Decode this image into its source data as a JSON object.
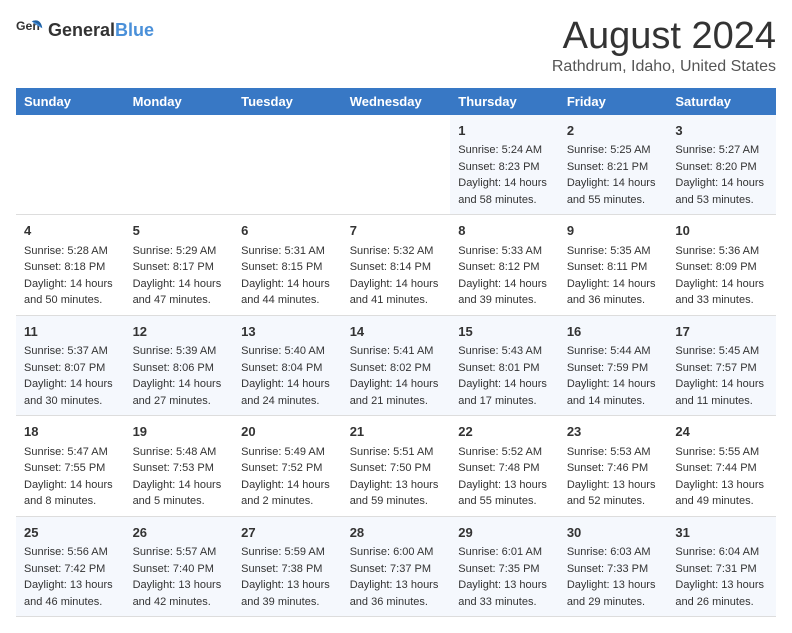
{
  "logo": {
    "general": "General",
    "blue": "Blue"
  },
  "title": "August 2024",
  "subtitle": "Rathdrum, Idaho, United States",
  "days_header": [
    "Sunday",
    "Monday",
    "Tuesday",
    "Wednesday",
    "Thursday",
    "Friday",
    "Saturday"
  ],
  "weeks": [
    [
      {
        "num": "",
        "sunrise": "",
        "sunset": "",
        "daylight": ""
      },
      {
        "num": "",
        "sunrise": "",
        "sunset": "",
        "daylight": ""
      },
      {
        "num": "",
        "sunrise": "",
        "sunset": "",
        "daylight": ""
      },
      {
        "num": "",
        "sunrise": "",
        "sunset": "",
        "daylight": ""
      },
      {
        "num": "1",
        "sunrise": "Sunrise: 5:24 AM",
        "sunset": "Sunset: 8:23 PM",
        "daylight": "Daylight: 14 hours and 58 minutes."
      },
      {
        "num": "2",
        "sunrise": "Sunrise: 5:25 AM",
        "sunset": "Sunset: 8:21 PM",
        "daylight": "Daylight: 14 hours and 55 minutes."
      },
      {
        "num": "3",
        "sunrise": "Sunrise: 5:27 AM",
        "sunset": "Sunset: 8:20 PM",
        "daylight": "Daylight: 14 hours and 53 minutes."
      }
    ],
    [
      {
        "num": "4",
        "sunrise": "Sunrise: 5:28 AM",
        "sunset": "Sunset: 8:18 PM",
        "daylight": "Daylight: 14 hours and 50 minutes."
      },
      {
        "num": "5",
        "sunrise": "Sunrise: 5:29 AM",
        "sunset": "Sunset: 8:17 PM",
        "daylight": "Daylight: 14 hours and 47 minutes."
      },
      {
        "num": "6",
        "sunrise": "Sunrise: 5:31 AM",
        "sunset": "Sunset: 8:15 PM",
        "daylight": "Daylight: 14 hours and 44 minutes."
      },
      {
        "num": "7",
        "sunrise": "Sunrise: 5:32 AM",
        "sunset": "Sunset: 8:14 PM",
        "daylight": "Daylight: 14 hours and 41 minutes."
      },
      {
        "num": "8",
        "sunrise": "Sunrise: 5:33 AM",
        "sunset": "Sunset: 8:12 PM",
        "daylight": "Daylight: 14 hours and 39 minutes."
      },
      {
        "num": "9",
        "sunrise": "Sunrise: 5:35 AM",
        "sunset": "Sunset: 8:11 PM",
        "daylight": "Daylight: 14 hours and 36 minutes."
      },
      {
        "num": "10",
        "sunrise": "Sunrise: 5:36 AM",
        "sunset": "Sunset: 8:09 PM",
        "daylight": "Daylight: 14 hours and 33 minutes."
      }
    ],
    [
      {
        "num": "11",
        "sunrise": "Sunrise: 5:37 AM",
        "sunset": "Sunset: 8:07 PM",
        "daylight": "Daylight: 14 hours and 30 minutes."
      },
      {
        "num": "12",
        "sunrise": "Sunrise: 5:39 AM",
        "sunset": "Sunset: 8:06 PM",
        "daylight": "Daylight: 14 hours and 27 minutes."
      },
      {
        "num": "13",
        "sunrise": "Sunrise: 5:40 AM",
        "sunset": "Sunset: 8:04 PM",
        "daylight": "Daylight: 14 hours and 24 minutes."
      },
      {
        "num": "14",
        "sunrise": "Sunrise: 5:41 AM",
        "sunset": "Sunset: 8:02 PM",
        "daylight": "Daylight: 14 hours and 21 minutes."
      },
      {
        "num": "15",
        "sunrise": "Sunrise: 5:43 AM",
        "sunset": "Sunset: 8:01 PM",
        "daylight": "Daylight: 14 hours and 17 minutes."
      },
      {
        "num": "16",
        "sunrise": "Sunrise: 5:44 AM",
        "sunset": "Sunset: 7:59 PM",
        "daylight": "Daylight: 14 hours and 14 minutes."
      },
      {
        "num": "17",
        "sunrise": "Sunrise: 5:45 AM",
        "sunset": "Sunset: 7:57 PM",
        "daylight": "Daylight: 14 hours and 11 minutes."
      }
    ],
    [
      {
        "num": "18",
        "sunrise": "Sunrise: 5:47 AM",
        "sunset": "Sunset: 7:55 PM",
        "daylight": "Daylight: 14 hours and 8 minutes."
      },
      {
        "num": "19",
        "sunrise": "Sunrise: 5:48 AM",
        "sunset": "Sunset: 7:53 PM",
        "daylight": "Daylight: 14 hours and 5 minutes."
      },
      {
        "num": "20",
        "sunrise": "Sunrise: 5:49 AM",
        "sunset": "Sunset: 7:52 PM",
        "daylight": "Daylight: 14 hours and 2 minutes."
      },
      {
        "num": "21",
        "sunrise": "Sunrise: 5:51 AM",
        "sunset": "Sunset: 7:50 PM",
        "daylight": "Daylight: 13 hours and 59 minutes."
      },
      {
        "num": "22",
        "sunrise": "Sunrise: 5:52 AM",
        "sunset": "Sunset: 7:48 PM",
        "daylight": "Daylight: 13 hours and 55 minutes."
      },
      {
        "num": "23",
        "sunrise": "Sunrise: 5:53 AM",
        "sunset": "Sunset: 7:46 PM",
        "daylight": "Daylight: 13 hours and 52 minutes."
      },
      {
        "num": "24",
        "sunrise": "Sunrise: 5:55 AM",
        "sunset": "Sunset: 7:44 PM",
        "daylight": "Daylight: 13 hours and 49 minutes."
      }
    ],
    [
      {
        "num": "25",
        "sunrise": "Sunrise: 5:56 AM",
        "sunset": "Sunset: 7:42 PM",
        "daylight": "Daylight: 13 hours and 46 minutes."
      },
      {
        "num": "26",
        "sunrise": "Sunrise: 5:57 AM",
        "sunset": "Sunset: 7:40 PM",
        "daylight": "Daylight: 13 hours and 42 minutes."
      },
      {
        "num": "27",
        "sunrise": "Sunrise: 5:59 AM",
        "sunset": "Sunset: 7:38 PM",
        "daylight": "Daylight: 13 hours and 39 minutes."
      },
      {
        "num": "28",
        "sunrise": "Sunrise: 6:00 AM",
        "sunset": "Sunset: 7:37 PM",
        "daylight": "Daylight: 13 hours and 36 minutes."
      },
      {
        "num": "29",
        "sunrise": "Sunrise: 6:01 AM",
        "sunset": "Sunset: 7:35 PM",
        "daylight": "Daylight: 13 hours and 33 minutes."
      },
      {
        "num": "30",
        "sunrise": "Sunrise: 6:03 AM",
        "sunset": "Sunset: 7:33 PM",
        "daylight": "Daylight: 13 hours and 29 minutes."
      },
      {
        "num": "31",
        "sunrise": "Sunrise: 6:04 AM",
        "sunset": "Sunset: 7:31 PM",
        "daylight": "Daylight: 13 hours and 26 minutes."
      }
    ]
  ]
}
